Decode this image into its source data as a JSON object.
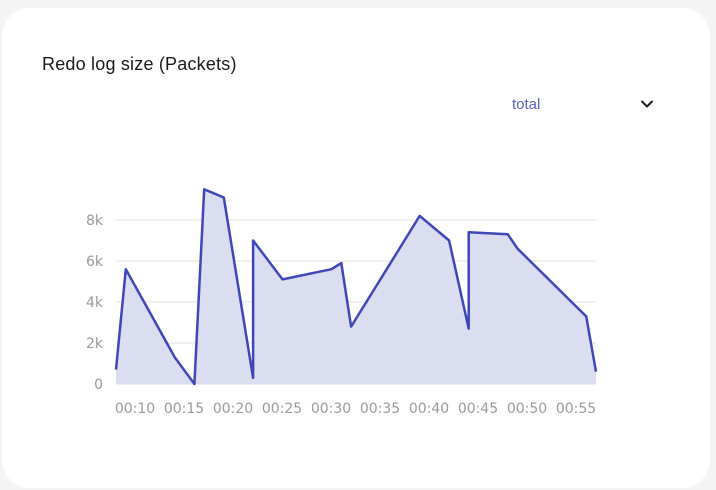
{
  "widget": {
    "title": "Redo log size (Packets)",
    "series_select": {
      "selected": "total",
      "icon": "chevron-down-icon"
    }
  },
  "colors": {
    "line": "#3f47b8",
    "fill": "#d9dbf0",
    "grid": "#e2e2e2",
    "tick_text": "#9a9a9a",
    "select_text": "#5b5fc7"
  },
  "chart_data": {
    "type": "area",
    "title": "Redo log size (Packets)",
    "xlabel": "",
    "ylabel": "",
    "x_ticks": [
      "00:10",
      "00:15",
      "00:20",
      "00:25",
      "00:30",
      "00:35",
      "00:40",
      "00:45",
      "00:50",
      "00:55"
    ],
    "y_ticks": [
      {
        "value": 0,
        "label": "0"
      },
      {
        "value": 2000,
        "label": "2k"
      },
      {
        "value": 4000,
        "label": "4k"
      },
      {
        "value": 6000,
        "label": "6k"
      },
      {
        "value": 8000,
        "label": "8k"
      }
    ],
    "xlim": [
      "00:08",
      "00:57"
    ],
    "ylim": [
      0,
      9500
    ],
    "grid": true,
    "legend": "none",
    "series": [
      {
        "x": [
          "00:08",
          "00:09",
          "00:14",
          "00:16",
          "00:17",
          "00:19",
          "00:22",
          "00:22",
          "00:25",
          "00:30",
          "00:31",
          "00:32",
          "00:39",
          "00:42",
          "00:44",
          "00:44",
          "00:48",
          "00:49",
          "00:56",
          "00:57"
        ],
        "values": [
          700,
          5600,
          1300,
          0,
          9500,
          9100,
          300,
          7000,
          5100,
          5600,
          5900,
          2800,
          8200,
          7000,
          2700,
          7400,
          7300,
          6600,
          3300,
          600
        ]
      }
    ]
  }
}
